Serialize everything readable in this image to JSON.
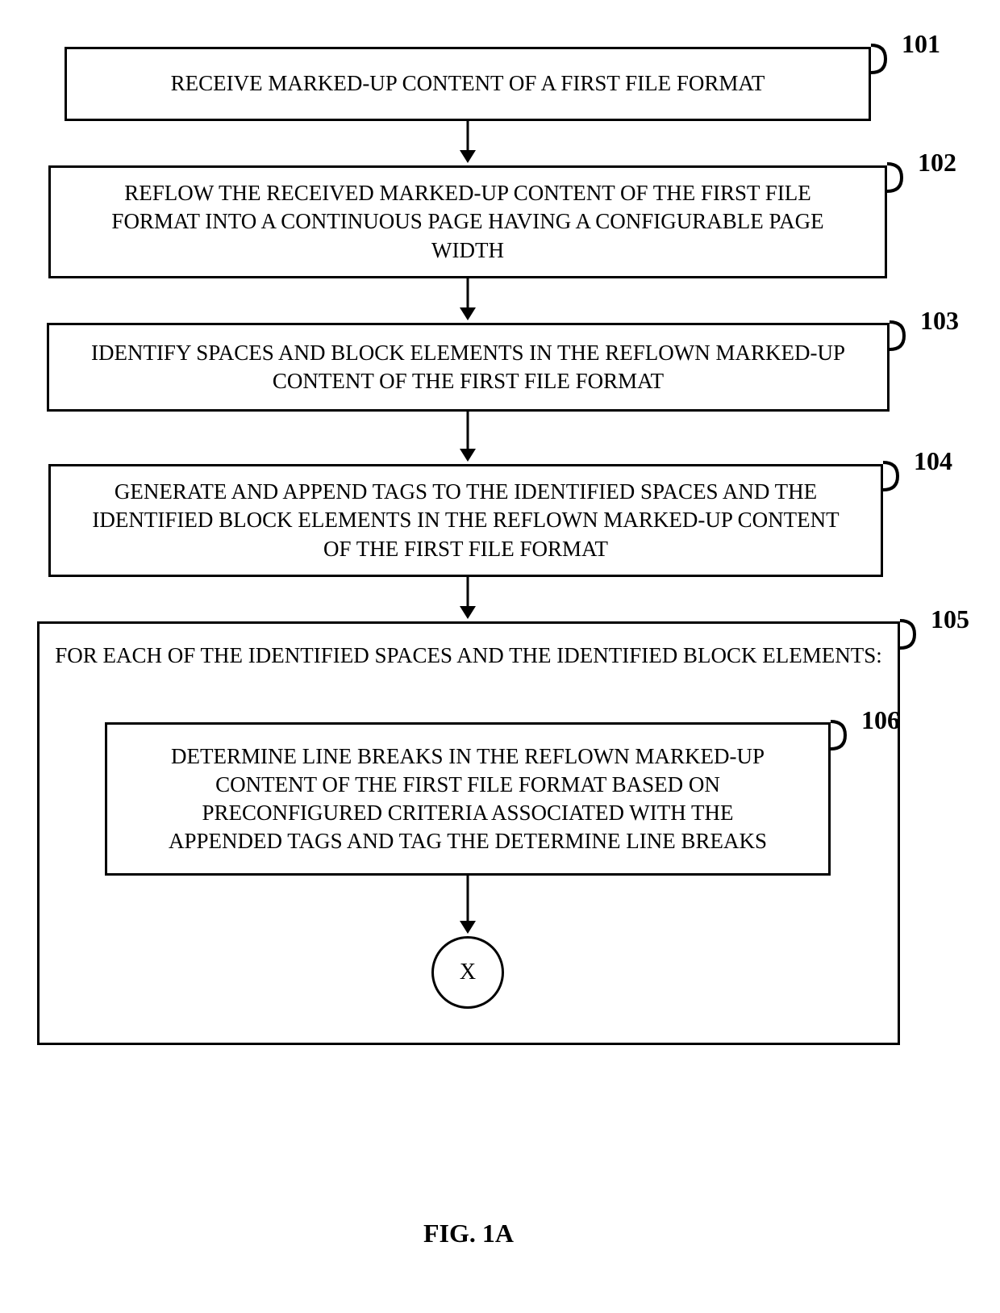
{
  "steps": {
    "101": {
      "ref": "101",
      "text": "RECEIVE MARKED-UP CONTENT OF A FIRST FILE FORMAT"
    },
    "102": {
      "ref": "102",
      "text": "REFLOW THE RECEIVED MARKED-UP CONTENT OF THE FIRST FILE FORMAT INTO A CONTINUOUS PAGE HAVING A CONFIGURABLE PAGE WIDTH"
    },
    "103": {
      "ref": "103",
      "text": "IDENTIFY SPACES AND BLOCK ELEMENTS IN THE REFLOWN MARKED-UP CONTENT OF THE FIRST FILE FORMAT"
    },
    "104": {
      "ref": "104",
      "text": "GENERATE AND APPEND TAGS TO THE IDENTIFIED SPACES AND THE IDENTIFIED BLOCK ELEMENTS IN THE REFLOWN MARKED-UP CONTENT OF THE FIRST FILE FORMAT"
    },
    "105": {
      "ref": "105",
      "text": "FOR EACH OF THE IDENTIFIED SPACES AND THE IDENTIFIED BLOCK ELEMENTS:"
    },
    "106": {
      "ref": "106",
      "text": "DETERMINE LINE BREAKS IN THE REFLOWN MARKED-UP CONTENT OF THE FIRST FILE FORMAT BASED ON PRECONFIGURED CRITERIA ASSOCIATED WITH THE APPENDED TAGS AND TAG THE DETERMINE LINE BREAKS"
    }
  },
  "connector": "X",
  "figure_label": "FIG. 1A"
}
